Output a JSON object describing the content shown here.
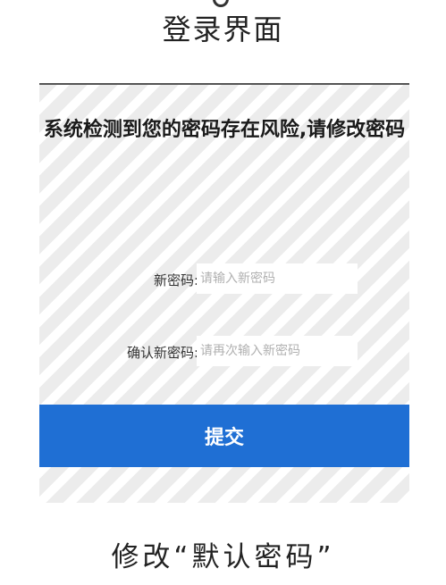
{
  "top_caption": "登录界面",
  "panel": {
    "title": "系统检测到您的密码存在风险,请修改密码",
    "new_password": {
      "label": "新密码:",
      "placeholder": "请输入新密码"
    },
    "confirm_password": {
      "label": "确认新密码:",
      "placeholder": "请再次输入新密码"
    },
    "submit_label": "提交"
  },
  "bottom_caption": "修改“默认密码”",
  "colors": {
    "accent": "#1f6fd4",
    "panel_background": "#ececec",
    "stripe": "#ffffff"
  },
  "icons": {
    "top_ring": "circle-icon"
  }
}
